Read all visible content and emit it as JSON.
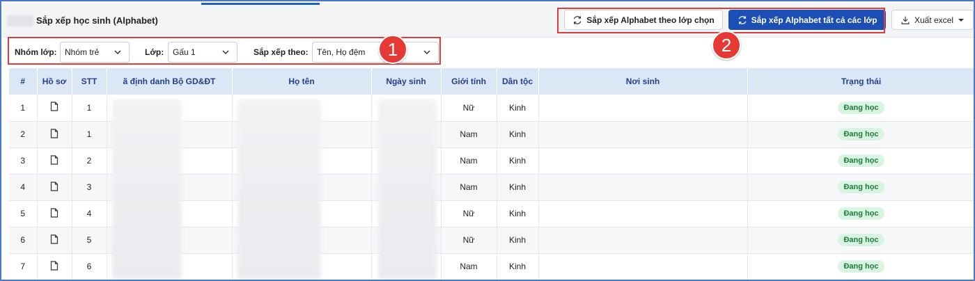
{
  "header": {
    "title": "Sắp xếp học sinh (Alphabet)",
    "btn_sort_selected": "Sắp xếp Alphabet theo lớp chọn",
    "btn_sort_all": "Sắp xếp Alphabet tất cả các lớp",
    "btn_export": "Xuất excel"
  },
  "filters": {
    "group_label": "Nhóm lớp:",
    "group_value": "Nhóm trẻ",
    "class_label": "Lớp:",
    "class_value": "Gấu 1",
    "sort_label": "Sắp xếp theo:",
    "sort_value": "Tên, Họ đệm"
  },
  "annotations": {
    "one": "1",
    "two": "2"
  },
  "colors": {
    "primary": "#1c4fb5",
    "highlight": "#e03c3c",
    "header_bg": "#dbe7f5",
    "status_bg": "#d9f5e2"
  },
  "table": {
    "columns": [
      "#",
      "Hồ sơ",
      "STT",
      "ã định danh Bộ GD&ĐT",
      "Họ tên",
      "Ngày sinh",
      "Giới tính",
      "Dân tộc",
      "Nơi sinh",
      "Trạng thái"
    ],
    "rows": [
      {
        "index": "1",
        "stt": "1",
        "gender": "Nữ",
        "ethnicity": "Kinh",
        "status": "Đang học"
      },
      {
        "index": "2",
        "stt": "1",
        "gender": "Nam",
        "ethnicity": "Kinh",
        "status": "Đang học"
      },
      {
        "index": "3",
        "stt": "2",
        "gender": "Nam",
        "ethnicity": "Kinh",
        "status": "Đang học"
      },
      {
        "index": "4",
        "stt": "3",
        "gender": "Nam",
        "ethnicity": "Kinh",
        "status": "Đang học"
      },
      {
        "index": "5",
        "stt": "4",
        "gender": "Nữ",
        "ethnicity": "Kinh",
        "status": "Đang học"
      },
      {
        "index": "6",
        "stt": "5",
        "gender": "Nữ",
        "ethnicity": "Kinh",
        "status": "Đang học"
      },
      {
        "index": "7",
        "stt": "6",
        "gender": "Nam",
        "ethnicity": "Kinh",
        "status": "Đang học"
      }
    ]
  }
}
